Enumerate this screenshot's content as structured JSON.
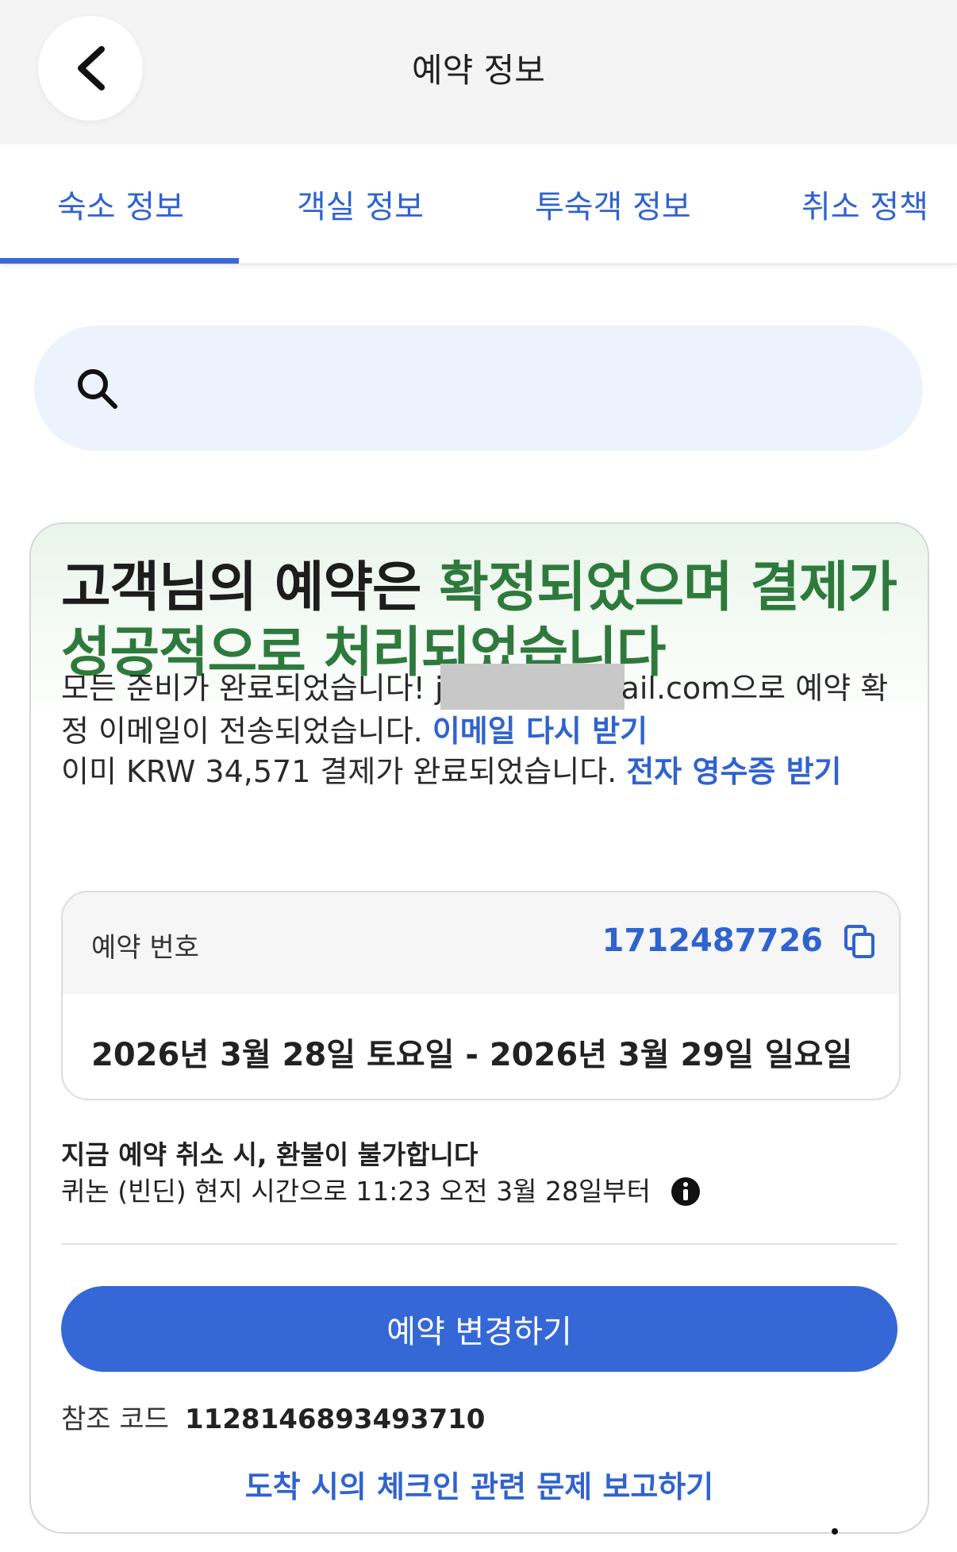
{
  "header": {
    "title": "예약 정보"
  },
  "tabs": [
    {
      "label": "숙소 정보",
      "active": true
    },
    {
      "label": "객실 정보",
      "active": false
    },
    {
      "label": "투숙객 정보",
      "active": false
    },
    {
      "label": "취소 정책",
      "active": false
    }
  ],
  "search": {
    "placeholder": ""
  },
  "confirmation": {
    "headline_part1": "고객님의 예약은 ",
    "headline_part2": "확정되었으며 결제가 성공적으로 처리되었습니다",
    "email_prefix": "모든 준비가 완료되었습니다! j",
    "email_suffix": "ail.com으로 예약 확정 이메일이 전송되었습니다. ",
    "resend_link": "이메일 다시 받기",
    "payment_text": "이미 KRW 34,571 결제가 완료되었습니다. ",
    "receipt_link": "전자 영수증 받기"
  },
  "booking": {
    "label": "예약 번호",
    "number": "1712487726",
    "dates": "2026년 3월 28일 토요일 - 2026년 3월 29일 일요일"
  },
  "cancellation": {
    "title": "지금 예약 취소 시, 환불이 불가합니다",
    "subtitle": "퀴논 (빈딘) 현지 시간으로 11:23 오전 3월 28일부터"
  },
  "actions": {
    "modify_label": "예약 변경하기",
    "reference_label": "참조 코드",
    "reference_code": "1128146893493710",
    "report_link": "도착 시의 체크인 관련 문제 보고하기"
  },
  "colors": {
    "accent": "#2f63cf",
    "success": "#2e7a3c",
    "button": "#3568d6"
  }
}
